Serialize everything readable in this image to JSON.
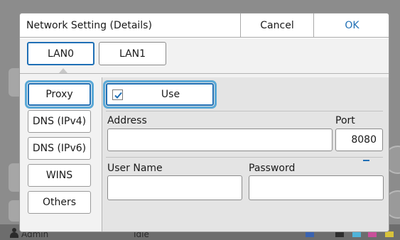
{
  "dialog": {
    "title": "Network Setting (Details)",
    "cancel_label": "Cancel",
    "ok_label": "OK"
  },
  "lan_tabs": [
    {
      "label": "LAN0",
      "selected": true
    },
    {
      "label": "LAN1",
      "selected": false
    }
  ],
  "categories": [
    {
      "label": "Proxy",
      "selected": true
    },
    {
      "label": "DNS (IPv4)",
      "selected": false
    },
    {
      "label": "DNS (IPv6)",
      "selected": false
    },
    {
      "label": "WINS",
      "selected": false
    },
    {
      "label": "Others",
      "selected": false
    }
  ],
  "proxy": {
    "use_label": "Use",
    "use_checked": true,
    "address_label": "Address",
    "address_value": "",
    "port_label": "Port",
    "port_value": "8080",
    "username_label": "User Name",
    "username_value": "",
    "password_label": "Password",
    "password_value": ""
  },
  "background": {
    "user_text": "Admin",
    "status_text": "Idle"
  },
  "colors": {
    "accent": "#1f6fb5",
    "focus_ring": "#5aa8d6",
    "ok_text": "#1f6fb5"
  }
}
